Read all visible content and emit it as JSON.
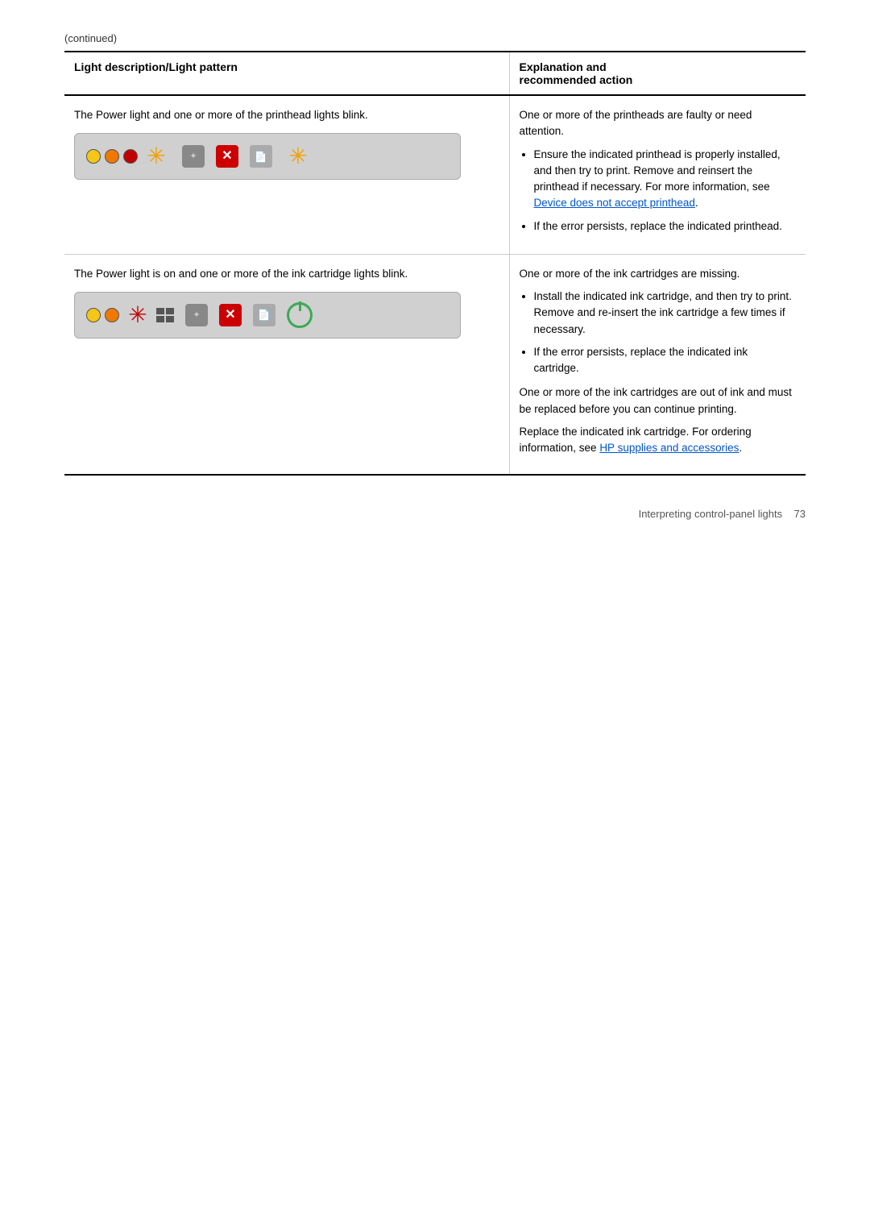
{
  "continued_label": "(continued)",
  "table": {
    "col1_header": "Light description/Light pattern",
    "col2_header": "Explanation and\nrecommended action",
    "rows": [
      {
        "id": "row1",
        "description": "The Power light and one or more of the printhead lights blink.",
        "explanation_paras": [
          "One or more of the printheads are faulty or need attention."
        ],
        "bullets": [
          "Ensure the indicated printhead is properly installed, and then try to print. Remove and reinsert the printhead if necessary. For more information, see [Device does not accept printhead].",
          "If the error persists, replace the indicated printhead."
        ],
        "link1_text": "Device does not accept printhead",
        "link1_href": "#"
      },
      {
        "id": "row2",
        "description": "The Power light is on and one or more of the ink cartridge lights blink.",
        "explanation_paras": [
          "One or more of the ink cartridges are missing.",
          "One or more of the ink cartridges are out of ink and must be replaced before you can continue printing.",
          "Replace the indicated ink cartridge. For ordering information, see [HP supplies and accessories]."
        ],
        "bullets": [
          "Install the indicated ink cartridge, and then try to print. Remove and re-insert the ink cartridge a few times if necessary.",
          "If the error persists, replace the indicated ink cartridge."
        ],
        "link2_text": "HP supplies and accessories",
        "link2_href": "#"
      }
    ]
  },
  "footer": {
    "left": "",
    "center": "Interpreting control-panel lights",
    "right": "73"
  }
}
